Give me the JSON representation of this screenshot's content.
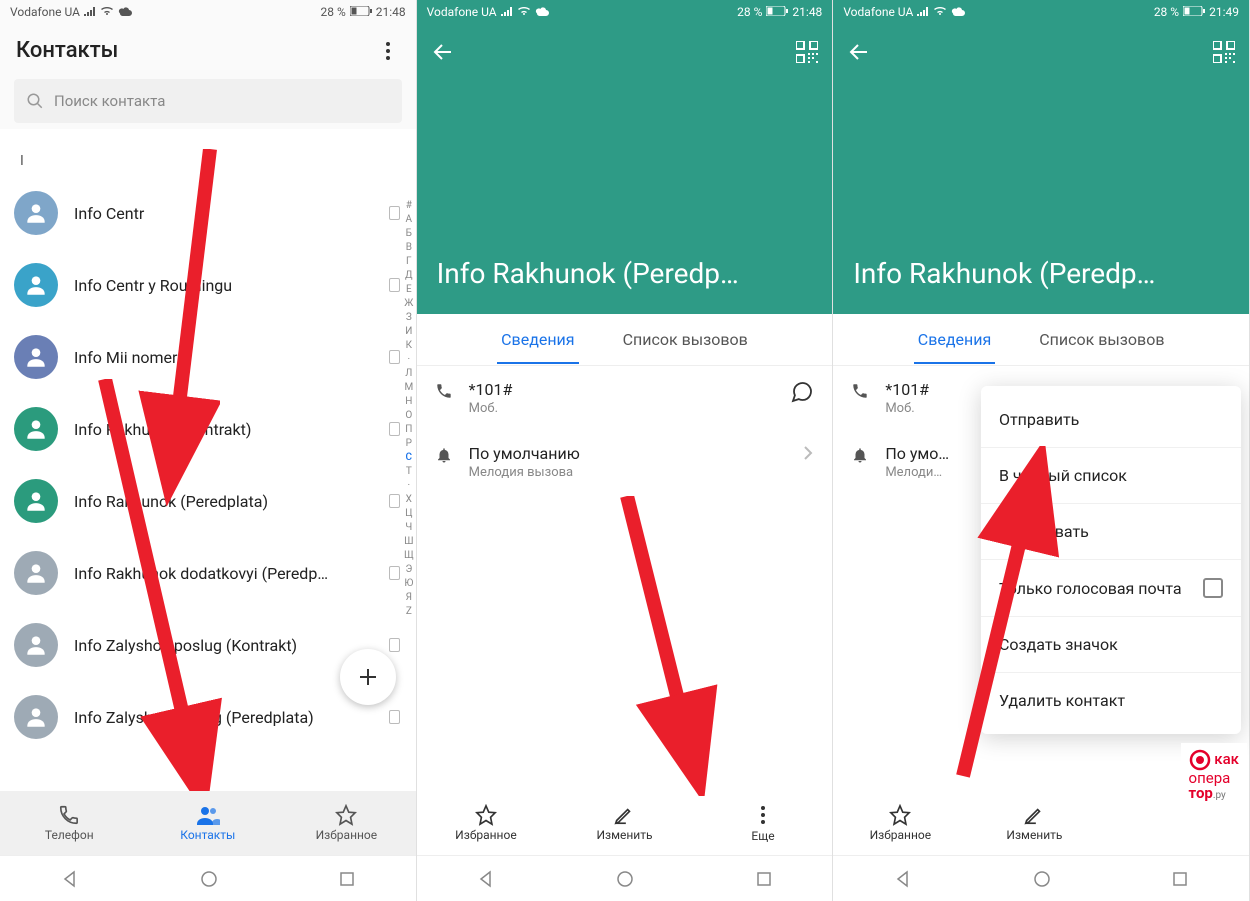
{
  "status": {
    "carrier": "Vodafone UA",
    "battery": "28 %",
    "time1": "21:48",
    "time2": "21:48",
    "time3": "21:49"
  },
  "screen1": {
    "title": "Контакты",
    "search_placeholder": "Поиск контакта",
    "section_letter": "I",
    "contacts": [
      {
        "name": "Info Centr",
        "color": "#7fa6c9"
      },
      {
        "name": "Info Centr y Roumingu",
        "color": "#3aa3c9"
      },
      {
        "name": "Info Mii nomer",
        "color": "#6a7fb5"
      },
      {
        "name": "Info Rakhunok (Kontrakt)",
        "color": "#2b9b7d"
      },
      {
        "name": "Info Rakhunok (Peredplata)",
        "color": "#2b9b7d"
      },
      {
        "name": "Info Rakhunok dodatkovyi (Peredp…",
        "color": "#9eaab5"
      },
      {
        "name": "Info Zalyshok poslug (Kontrakt)",
        "color": "#9eaab5"
      },
      {
        "name": "Info Zalyshok poslug (Peredplata)",
        "color": "#9eaab5"
      }
    ],
    "alpha_index": [
      "#",
      "A",
      "Б",
      "В",
      "Г",
      "Д",
      "E",
      "Ж",
      "З",
      "И",
      "К",
      "·",
      "Л",
      "М",
      "Н",
      "O",
      "П",
      "Р",
      "С",
      "Т",
      "·",
      "Х",
      "Ц",
      "Ч",
      "Ш",
      "Щ",
      "Э",
      "Ю",
      "Я",
      "Z"
    ],
    "alpha_current_index": 18,
    "tabs": [
      {
        "label": "Телефон",
        "icon": "phone"
      },
      {
        "label": "Контакты",
        "icon": "contacts"
      },
      {
        "label": "Избранное",
        "icon": "star"
      }
    ],
    "active_tab": 1
  },
  "detail": {
    "contact_title": "Info Rakhunok (Peredp…",
    "tabs": {
      "details": "Сведения",
      "call_log": "Список вызовов"
    },
    "phone": {
      "number": "*101#",
      "type": "Моб."
    },
    "ringtone": {
      "value": "По умолчанию",
      "label": "Мелодия вызова",
      "value_short": "По умо…",
      "label_short": "Мелоди…"
    },
    "actions": {
      "favorite": "Избранное",
      "edit": "Изменить",
      "more": "Еще"
    }
  },
  "popup": {
    "items": [
      "Отправить",
      "В черный список",
      "Копировать",
      "Только голосовая почта",
      "Создать значок",
      "Удалить контакт"
    ]
  },
  "watermark": {
    "line1": "как",
    "line2": "опера",
    "line3": "тор",
    "suffix": ".ру"
  }
}
